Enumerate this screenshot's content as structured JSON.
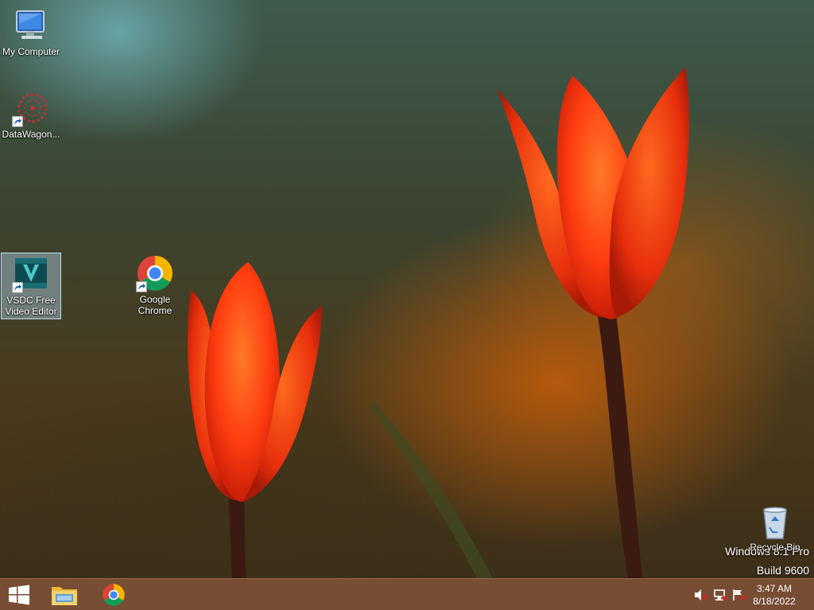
{
  "desktop": {
    "icons": [
      {
        "label": "My Computer",
        "icon": "computer-icon"
      },
      {
        "label": "DataWagon...",
        "icon": "datawagon-icon"
      },
      {
        "label": "VSDC Free Video Editor",
        "icon": "vsdc-icon",
        "selected": true
      },
      {
        "label": "Google Chrome",
        "icon": "chrome-icon"
      },
      {
        "label": "Recycle Bin",
        "icon": "recycle-bin-icon"
      }
    ],
    "watermark": {
      "line1": "Windows 8.1 Pro",
      "line2": "Build 9600"
    }
  },
  "taskbar": {
    "pinned": [
      {
        "name": "start-button",
        "icon": "windows-logo-icon"
      },
      {
        "name": "file-explorer",
        "icon": "folder-icon"
      },
      {
        "name": "google-chrome",
        "icon": "chrome-icon"
      }
    ],
    "tray": {
      "icons": [
        "volume-muted-icon",
        "network-icon",
        "action-center-flag-icon"
      ],
      "time": "3:47 AM",
      "date": "8/18/2022"
    }
  },
  "colors": {
    "taskbar": "#7d5037",
    "tulip": "#ff4a10",
    "selection": "#add0e8"
  }
}
